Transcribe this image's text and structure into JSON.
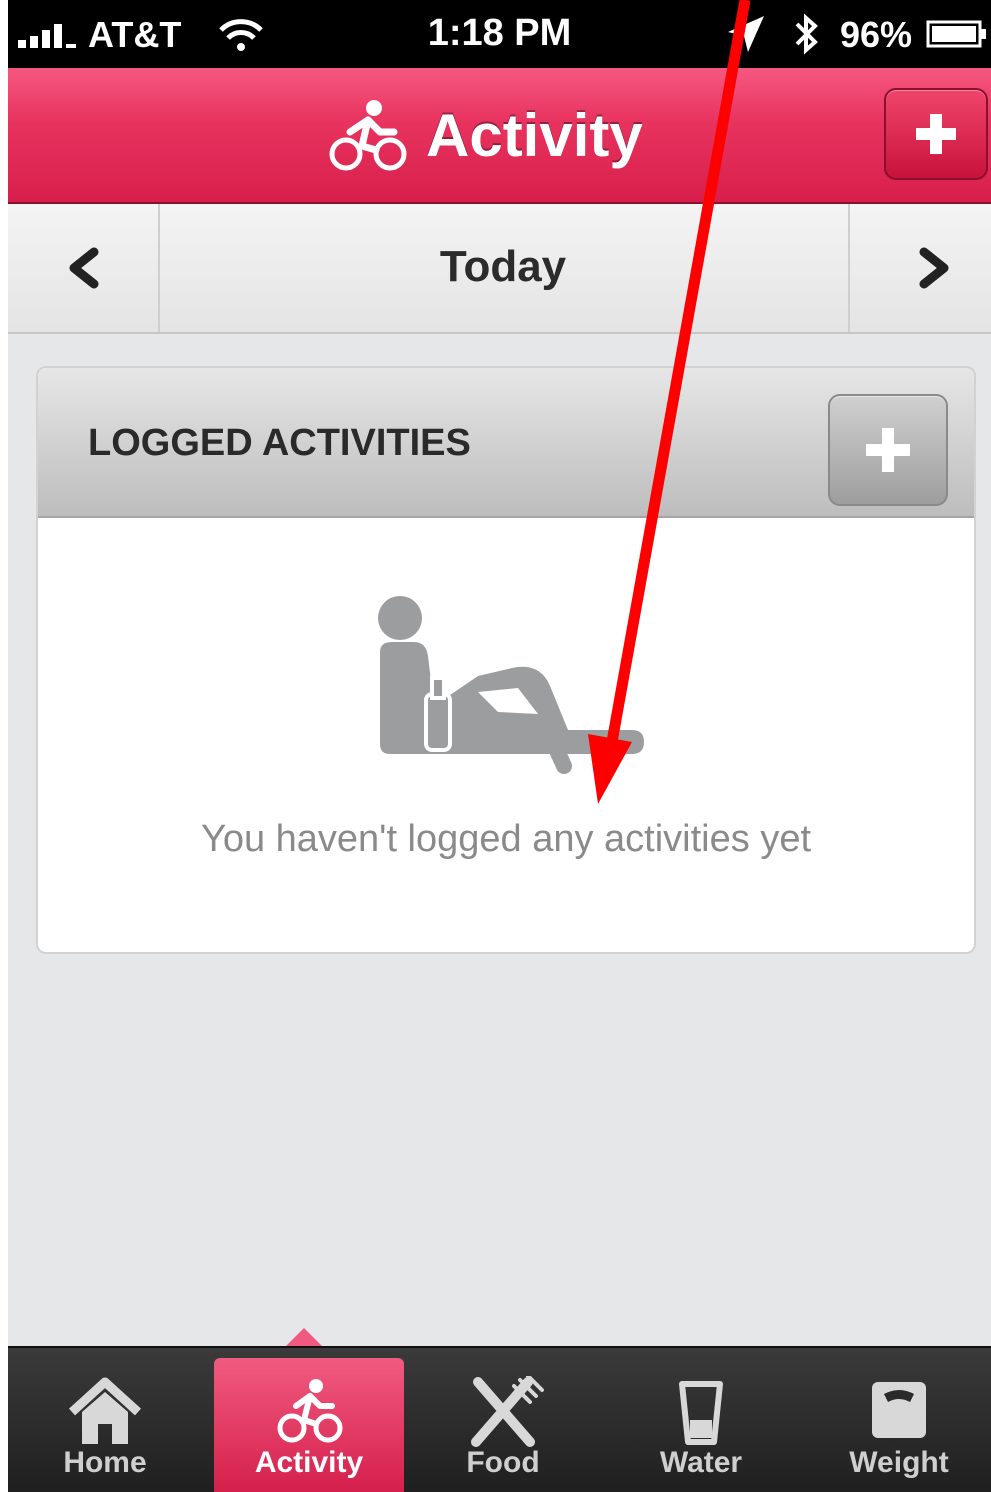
{
  "status_bar": {
    "carrier": "AT&T",
    "time": "1:18 PM",
    "battery": "96%"
  },
  "nav": {
    "title": "Activity"
  },
  "date_nav": {
    "label": "Today"
  },
  "card": {
    "title": "LOGGED ACTIVITIES",
    "empty_message": "You haven't logged any activities yet"
  },
  "tabs": [
    {
      "label": "Home",
      "icon": "home-icon"
    },
    {
      "label": "Activity",
      "icon": "bike-icon",
      "active": true
    },
    {
      "label": "Food",
      "icon": "fork-knife-icon"
    },
    {
      "label": "Water",
      "icon": "glass-icon"
    },
    {
      "label": "Weight",
      "icon": "scale-icon"
    }
  ],
  "colors": {
    "accent": "#e8335f",
    "annotation_arrow": "#ff0000"
  }
}
